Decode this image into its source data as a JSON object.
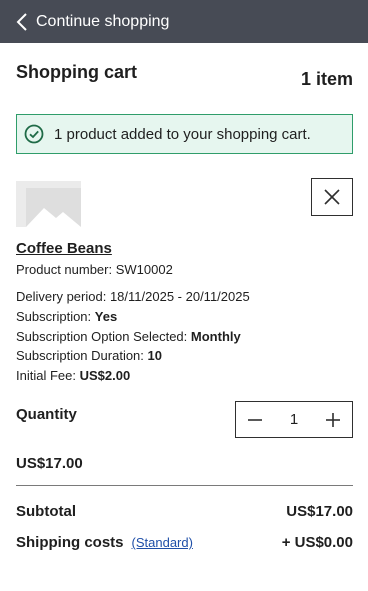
{
  "topbar": {
    "back_label": "Continue shopping"
  },
  "header": {
    "title": "Shopping cart",
    "item_count": "1 item"
  },
  "alert": {
    "message": "1 product added to your shopping cart."
  },
  "product": {
    "name": "Coffee Beans",
    "number_label": "Product number:",
    "number_value": "SW10002",
    "delivery_label": "Delivery period:",
    "delivery_value": "18/11/2025 - 20/11/2025",
    "subscription_label": "Subscription:",
    "subscription_value": "Yes",
    "option_label": "Subscription Option Selected:",
    "option_value": "Monthly",
    "duration_label": "Subscription Duration:",
    "duration_value": "10",
    "fee_label": "Initial Fee:",
    "fee_value": "US$2.00"
  },
  "quantity": {
    "label": "Quantity",
    "value": "1"
  },
  "line_total": "US$17.00",
  "summary": {
    "subtotal_label": "Subtotal",
    "subtotal_value": "US$17.00",
    "shipping_label": "Shipping costs",
    "shipping_method": "(Standard)",
    "shipping_value": "+ US$0.00"
  },
  "colors": {
    "topbar": "#474b55",
    "alert_bg": "#e6f6ef",
    "alert_border": "#2f9d6a",
    "link": "#1f4fa8"
  },
  "icons": [
    "chevron-left-icon",
    "check-circle-icon",
    "image-placeholder-icon",
    "close-icon",
    "minus-icon",
    "plus-icon"
  ]
}
